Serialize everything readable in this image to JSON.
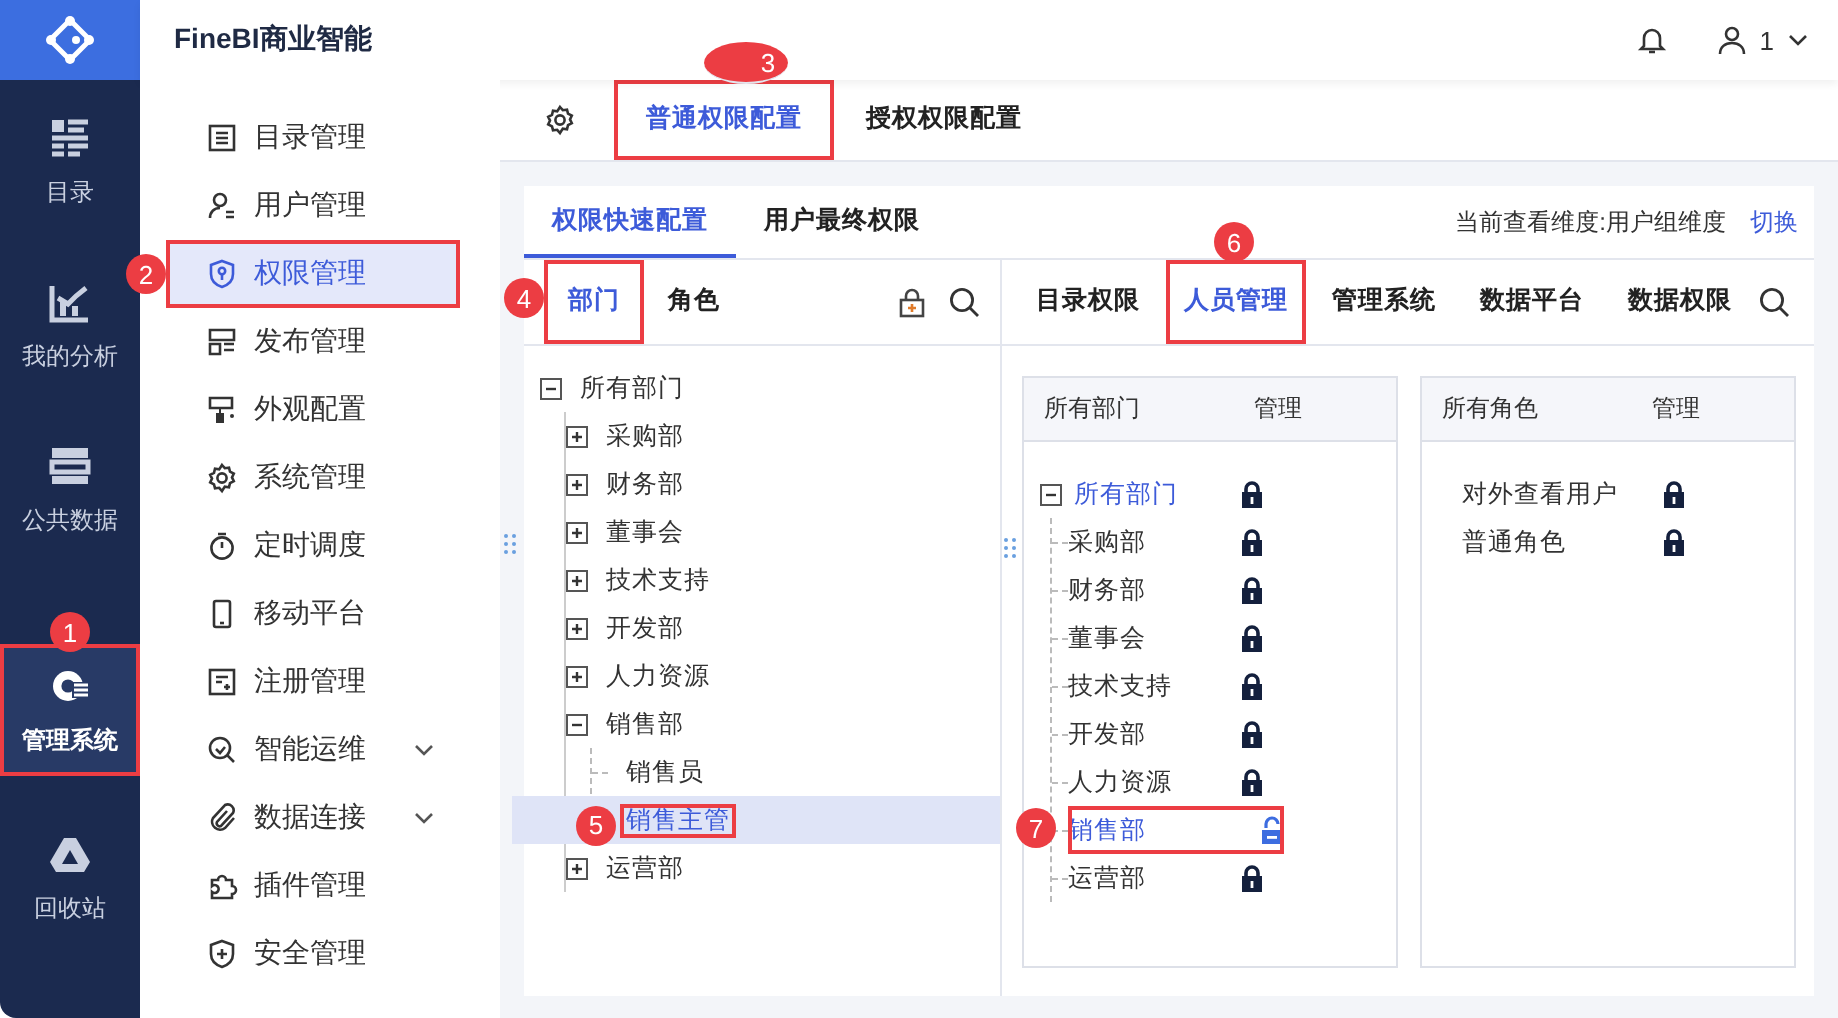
{
  "header": {
    "title": "FineBI商业智能",
    "user": "1"
  },
  "rail": [
    {
      "label": "目录",
      "kind": "catalog",
      "selected": false
    },
    {
      "label": "我的分析",
      "kind": "analysis",
      "selected": false
    },
    {
      "label": "公共数据",
      "kind": "data",
      "selected": false
    },
    {
      "label": "管理系统",
      "kind": "admin",
      "selected": true,
      "badge": "1"
    },
    {
      "label": "回收站",
      "kind": "trash",
      "selected": false
    }
  ],
  "menu": [
    {
      "label": "目录管理",
      "kind": "catalog",
      "selected": false
    },
    {
      "label": "用户管理",
      "kind": "user",
      "selected": false
    },
    {
      "label": "权限管理",
      "kind": "permission",
      "selected": true,
      "badge": "2"
    },
    {
      "label": "发布管理",
      "kind": "publish",
      "selected": false
    },
    {
      "label": "外观配置",
      "kind": "appearance",
      "selected": false
    },
    {
      "label": "系统管理",
      "kind": "system",
      "selected": false
    },
    {
      "label": "定时调度",
      "kind": "schedule",
      "selected": false
    },
    {
      "label": "移动平台",
      "kind": "mobile",
      "selected": false
    },
    {
      "label": "注册管理",
      "kind": "register",
      "selected": false
    },
    {
      "label": "智能运维",
      "kind": "ops",
      "selected": false,
      "expanded": false
    },
    {
      "label": "数据连接",
      "kind": "connection",
      "selected": false,
      "expanded": false
    },
    {
      "label": "插件管理",
      "kind": "plugin",
      "selected": false
    },
    {
      "label": "安全管理",
      "kind": "security",
      "selected": false
    }
  ],
  "top_tabs": [
    {
      "label": "普通权限配置",
      "selected": true,
      "badge": "3"
    },
    {
      "label": "授权权限配置",
      "selected": false
    }
  ],
  "sub_tabs": [
    {
      "label": "权限快速配置",
      "selected": true
    },
    {
      "label": "用户最终权限",
      "selected": false
    }
  ],
  "dimension": {
    "label": "当前查看维度:用户组维度",
    "action": "切换"
  },
  "left_tabs": [
    {
      "label": "部门",
      "selected": true,
      "badge": "4"
    },
    {
      "label": "角色",
      "selected": false
    }
  ],
  "dept_tree": {
    "label": "所有部门",
    "expanded": true,
    "selected": false,
    "children": [
      {
        "label": "采购部",
        "expanded": false,
        "selected": false
      },
      {
        "label": "财务部",
        "expanded": false,
        "selected": false
      },
      {
        "label": "董事会",
        "expanded": false,
        "selected": false
      },
      {
        "label": "技术支持",
        "expanded": false,
        "selected": false
      },
      {
        "label": "开发部",
        "expanded": false,
        "selected": false
      },
      {
        "label": "人力资源",
        "expanded": false,
        "selected": false
      },
      {
        "label": "销售部",
        "expanded": true,
        "selected": false,
        "children": [
          {
            "label": "销售员",
            "selected": false
          },
          {
            "label": "销售主管",
            "selected": true,
            "badge": "5"
          }
        ]
      },
      {
        "label": "运营部",
        "expanded": false,
        "selected": false
      }
    ]
  },
  "perm_tabs": [
    {
      "label": "目录权限",
      "selected": false
    },
    {
      "label": "人员管理",
      "selected": true,
      "badge": "6"
    },
    {
      "label": "管理系统",
      "selected": false
    },
    {
      "label": "数据平台",
      "selected": false
    },
    {
      "label": "数据权限",
      "selected": false
    }
  ],
  "dept_panel": {
    "columns": [
      "所有部门",
      "管理"
    ],
    "root": {
      "label": "所有部门",
      "expanded": true,
      "active": true,
      "locked": true,
      "children": [
        {
          "label": "采购部",
          "active": false,
          "locked": true
        },
        {
          "label": "财务部",
          "active": false,
          "locked": true
        },
        {
          "label": "董事会",
          "active": false,
          "locked": true
        },
        {
          "label": "技术支持",
          "active": false,
          "locked": true
        },
        {
          "label": "开发部",
          "active": false,
          "locked": true
        },
        {
          "label": "人力资源",
          "active": false,
          "locked": true
        },
        {
          "label": "销售部",
          "active": true,
          "locked": false,
          "badge": "7"
        },
        {
          "label": "运营部",
          "active": false,
          "locked": true
        }
      ]
    }
  },
  "role_panel": {
    "columns": [
      "所有角色",
      "管理"
    ],
    "rows": [
      {
        "label": "对外查看用户",
        "locked": true
      },
      {
        "label": "普通角色",
        "locked": true
      }
    ]
  }
}
